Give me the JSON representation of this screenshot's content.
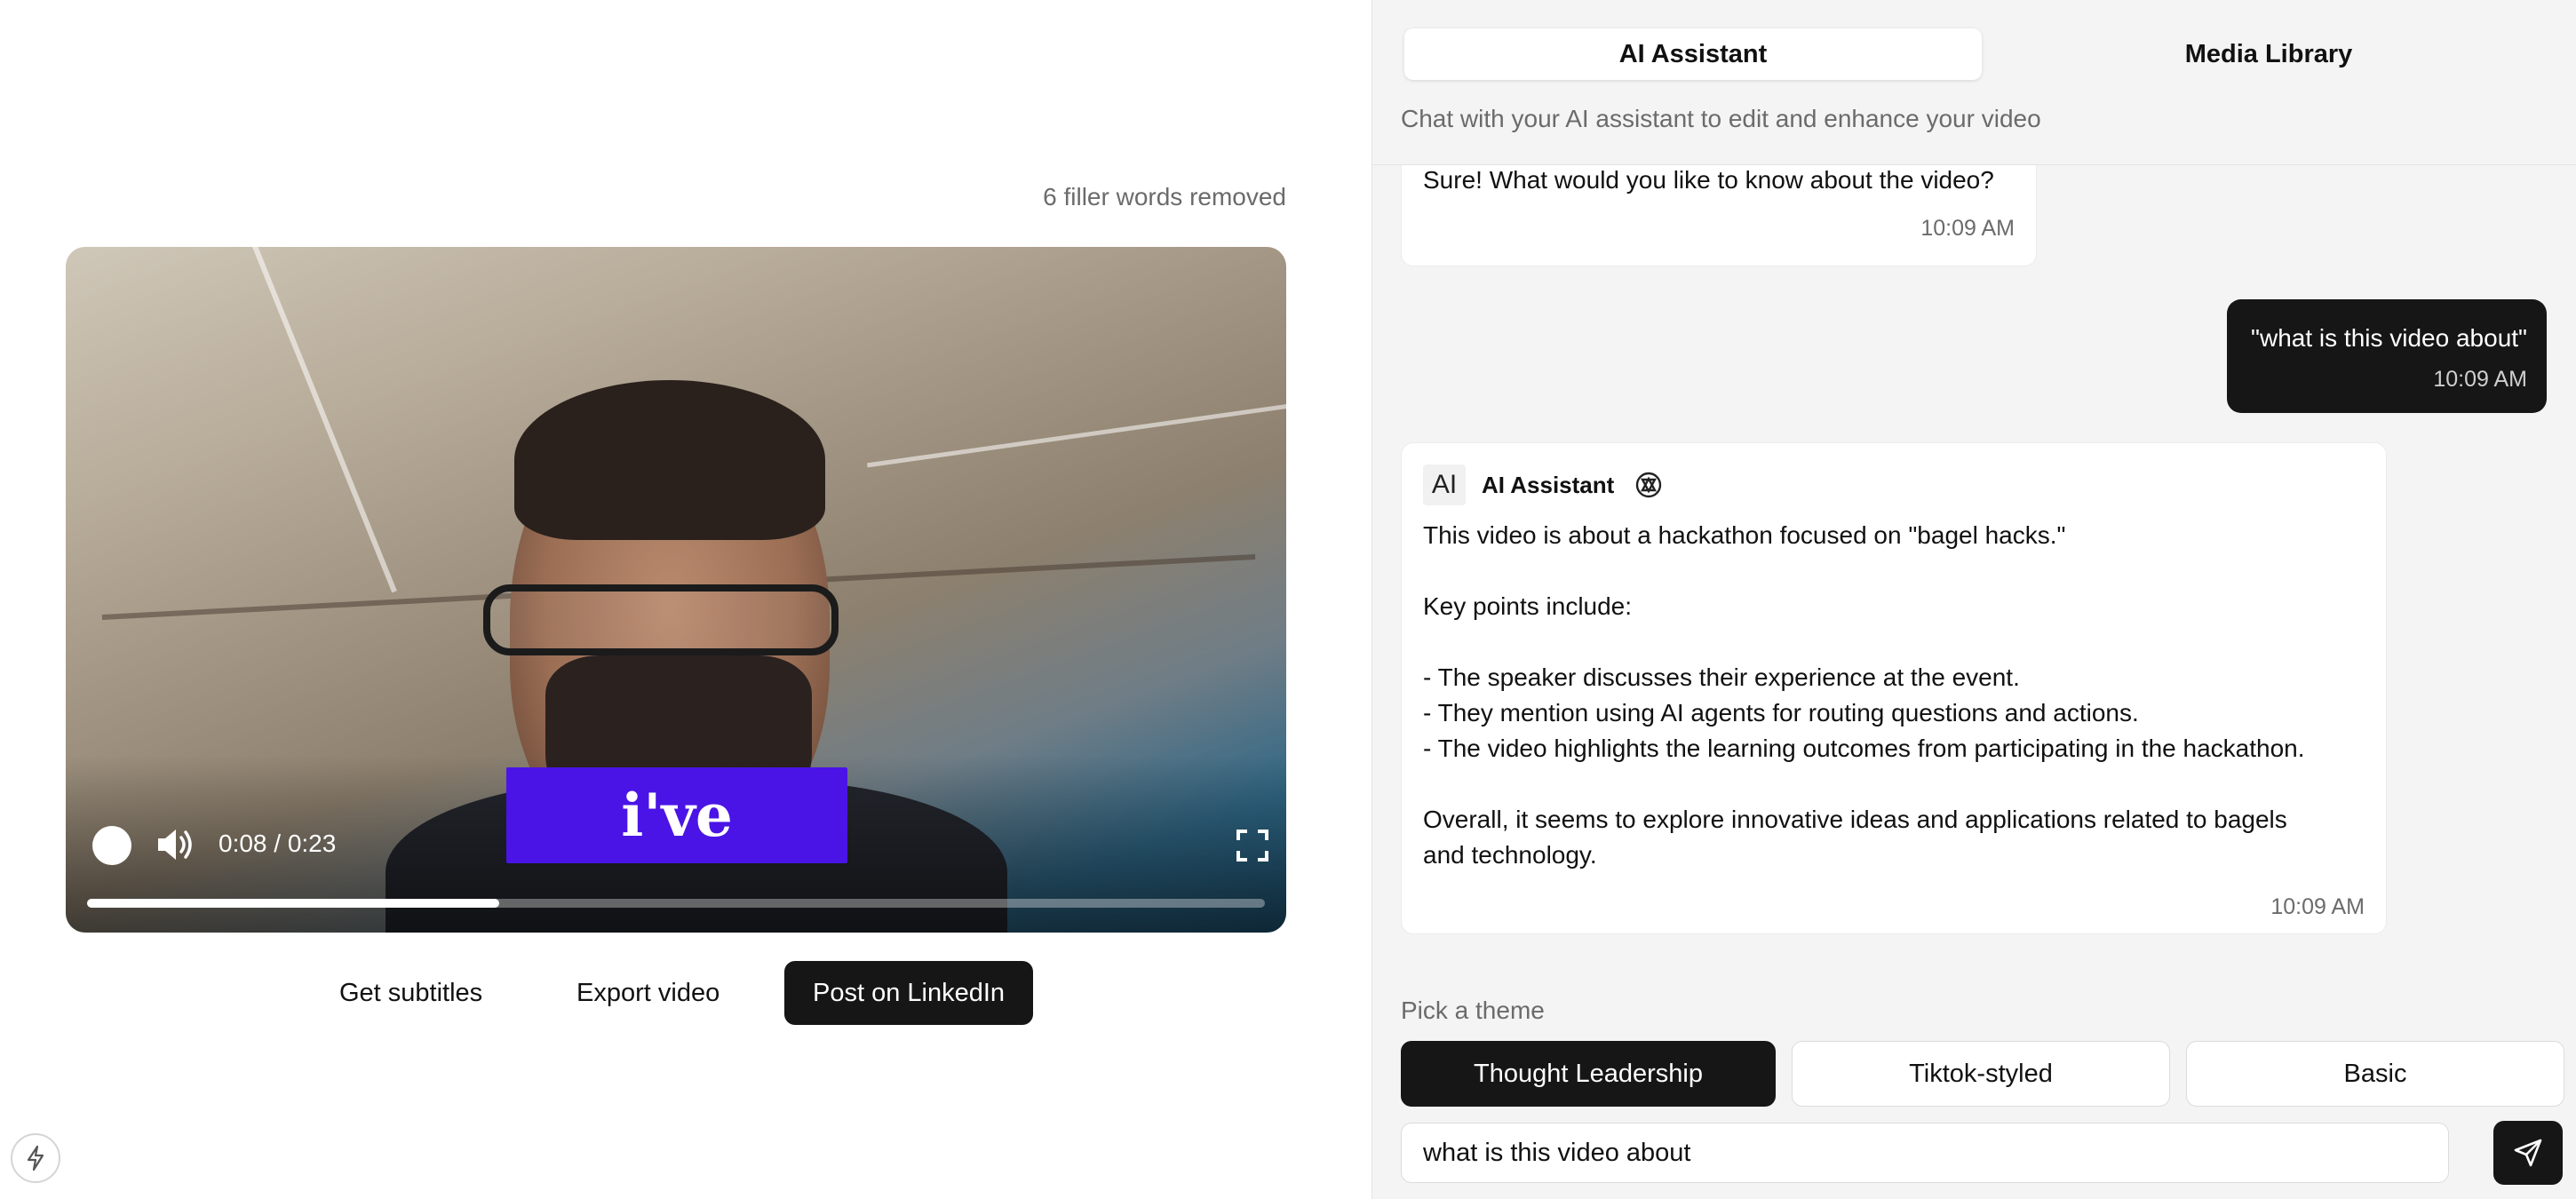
{
  "editor": {
    "filler_status": "6 filler words removed",
    "video": {
      "caption_word": "i've",
      "time": "0:08 / 0:23",
      "progress_fraction": 0.35
    },
    "actions": {
      "subtitles_label": "Get subtitles",
      "export_label": "Export video",
      "linkedin_label": "Post on LinkedIn"
    }
  },
  "panel": {
    "tabs": [
      {
        "label": "AI Assistant",
        "active": true
      },
      {
        "label": "Media Library",
        "active": false
      }
    ],
    "subtitle": "Chat with your AI assistant to edit and enhance your video",
    "messages": [
      {
        "role": "assistant",
        "text": "Sure! What would you like to know about the video?",
        "time": "10:09 AM"
      },
      {
        "role": "user",
        "text": "\"what is this video about\"",
        "time": "10:09 AM"
      },
      {
        "role": "assistant",
        "avatar": "AI",
        "name": "AI Assistant",
        "icon": "openai-icon",
        "text": "This video is about a hackathon focused on \"bagel hacks.\"\n\nKey points include:\n\n- The speaker discusses their experience at the event.\n- They mention using AI agents for routing questions and actions.\n- The video highlights the learning outcomes from participating in the hackathon.\n\nOverall, it seems to explore innovative ideas and applications related to bagels\nand technology.",
        "time": "10:09 AM"
      }
    ],
    "theme_label": "Pick a theme",
    "themes": [
      {
        "label": "Thought Leadership",
        "active": true
      },
      {
        "label": "Tiktok-styled",
        "active": false
      },
      {
        "label": "Basic",
        "active": false
      }
    ],
    "input_value": "what is this video about"
  }
}
